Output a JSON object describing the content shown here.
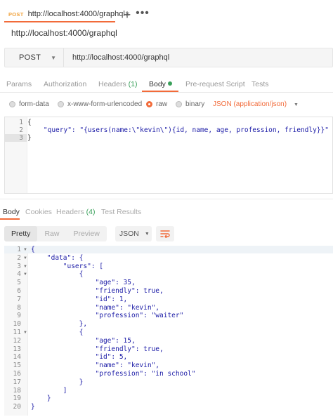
{
  "tab": {
    "method": "POST",
    "url": "http://localhost:4000/graphql",
    "close": "×",
    "new": "+",
    "more": "•••"
  },
  "title": "http://localhost:4000/graphql",
  "request": {
    "method": "POST",
    "url": "http://localhost:4000/graphql"
  },
  "req_tabs": {
    "params": "Params",
    "authorization": "Authorization",
    "headers": "Headers",
    "headers_count": "(1)",
    "body": "Body",
    "prerequest": "Pre-request Script",
    "tests": "Tests"
  },
  "body_types": {
    "form_data": "form-data",
    "urlencoded": "x-www-form-urlencoded",
    "raw": "raw",
    "binary": "binary",
    "selected": "raw",
    "content_type": "JSON (application/json)"
  },
  "request_body": {
    "line_numbers": [
      "1",
      "2",
      "3"
    ],
    "lines": [
      "{",
      "    \"query\": \"{users(name:\\\"kevin\\\"){id, name, age, profession, friendly}}\"",
      "}"
    ]
  },
  "resp_tabs": {
    "body": "Body",
    "cookies": "Cookies",
    "headers": "Headers",
    "headers_count": "(4)",
    "test_results": "Test Results"
  },
  "resp_toolbar": {
    "pretty": "Pretty",
    "raw": "Raw",
    "preview": "Preview",
    "format": "JSON"
  },
  "response_body": {
    "line_numbers": [
      "1",
      "2",
      "3",
      "4",
      "5",
      "6",
      "7",
      "8",
      "9",
      "10",
      "11",
      "12",
      "13",
      "14",
      "15",
      "16",
      "17",
      "18",
      "19",
      "20"
    ],
    "lines": [
      "{",
      "    \"data\": {",
      "        \"users\": [",
      "            {",
      "                \"age\": 35,",
      "                \"friendly\": true,",
      "                \"id\": 1,",
      "                \"name\": \"kevin\",",
      "                \"profession\": \"waiter\"",
      "            },",
      "            {",
      "                \"age\": 15,",
      "                \"friendly\": true,",
      "                \"id\": 5,",
      "                \"name\": \"kevin\",",
      "                \"profession\": \"in school\"",
      "            }",
      "        ]",
      "    }",
      "}"
    ]
  },
  "colors": {
    "accent": "#f26b3a",
    "method_tab": "#f0a13a",
    "count_green": "#39a05a",
    "code_blue": "#1a1aa6"
  }
}
